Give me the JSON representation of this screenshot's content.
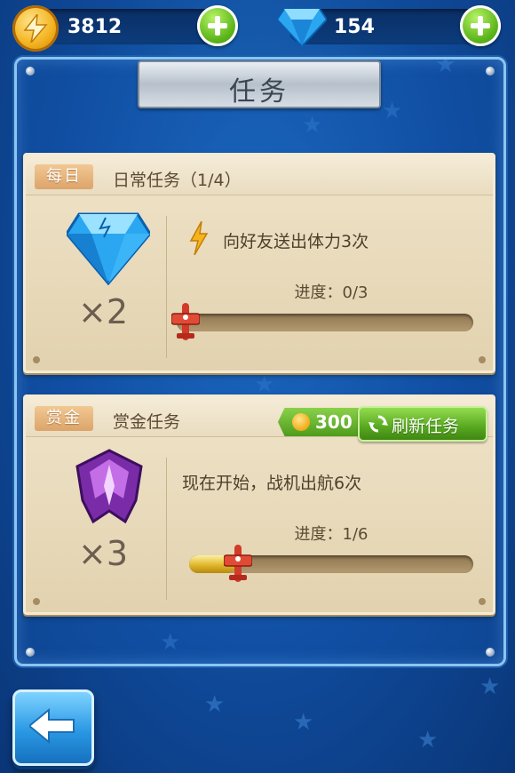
{
  "top_bar": {
    "coins": "3812",
    "gems": "154"
  },
  "panel": {
    "title": "任务"
  },
  "daily_task": {
    "tag": "每日",
    "title": "日常任务（1/4）",
    "reward_icon": "blue-gem-icon",
    "reward_multiplier": "×2",
    "description": "向好友送出体力3次",
    "progress_label": "进度：0/3",
    "progress_fraction": 0.0
  },
  "bounty_task": {
    "tag": "赏金",
    "title": "赏金任务",
    "refresh_cost": "300",
    "refresh_label": "刷新任务",
    "reward_icon": "purple-wing-emblem-icon",
    "reward_multiplier": "×3",
    "description": "现在开始，战机出航6次",
    "progress_label": "进度：1/6",
    "progress_fraction": 0.167
  },
  "colors": {
    "background": "#1f6fc4",
    "card": "#efe3c8",
    "accent_green": "#5cb51a",
    "progress_fill": "#e0b72b"
  }
}
